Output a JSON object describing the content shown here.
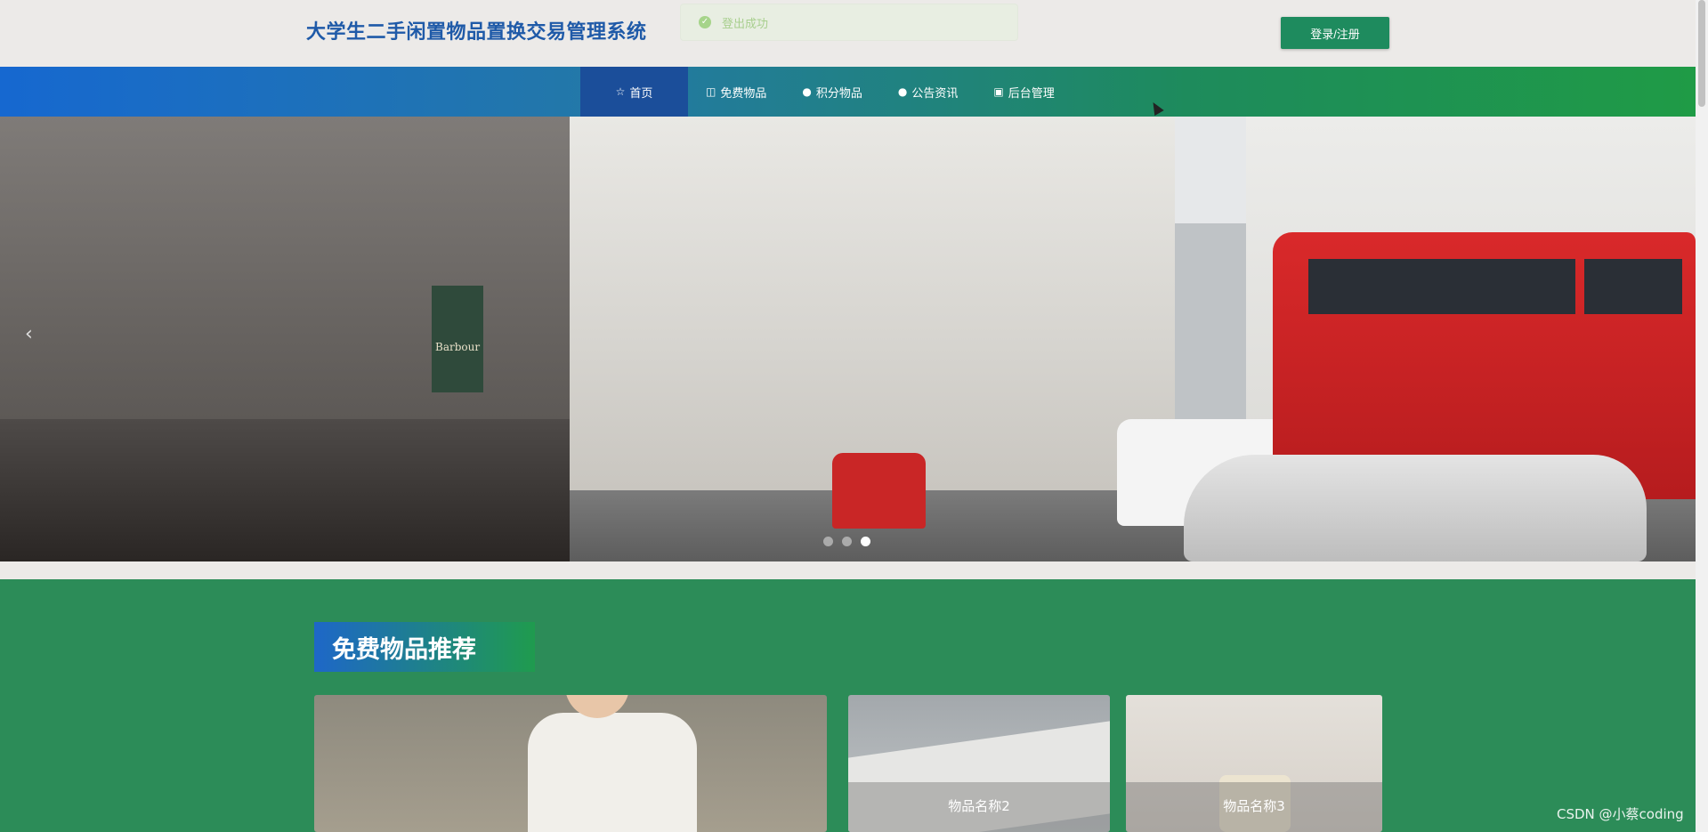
{
  "header": {
    "site_title": "大学生二手闲置物品置换交易管理系统",
    "toast_message": "登出成功",
    "login_button": "登录/注册"
  },
  "nav": {
    "items": [
      {
        "label": "首页",
        "icon": "star-icon",
        "active": true
      },
      {
        "label": "免费物品",
        "icon": "bag-icon",
        "active": false
      },
      {
        "label": "积分物品",
        "icon": "info-icon",
        "active": false
      },
      {
        "label": "公告资讯",
        "icon": "question-icon",
        "active": false
      },
      {
        "label": "后台管理",
        "icon": "briefcase-icon",
        "active": false
      }
    ]
  },
  "banner": {
    "prev_arrow": "‹",
    "slide_count": 3,
    "active_slide": 3,
    "flag_text": "Barbour"
  },
  "section": {
    "title": "免费物品推荐",
    "cards": [
      {
        "label": ""
      },
      {
        "label": "物品名称2"
      },
      {
        "label": "物品名称3"
      }
    ]
  },
  "watermark": "CSDN @小蔡coding",
  "colors": {
    "brand_blue": "#1f5aa8",
    "button_green": "#1e8b5e",
    "section_green": "#2c8c58",
    "nav_active": "#1b4e9a"
  }
}
